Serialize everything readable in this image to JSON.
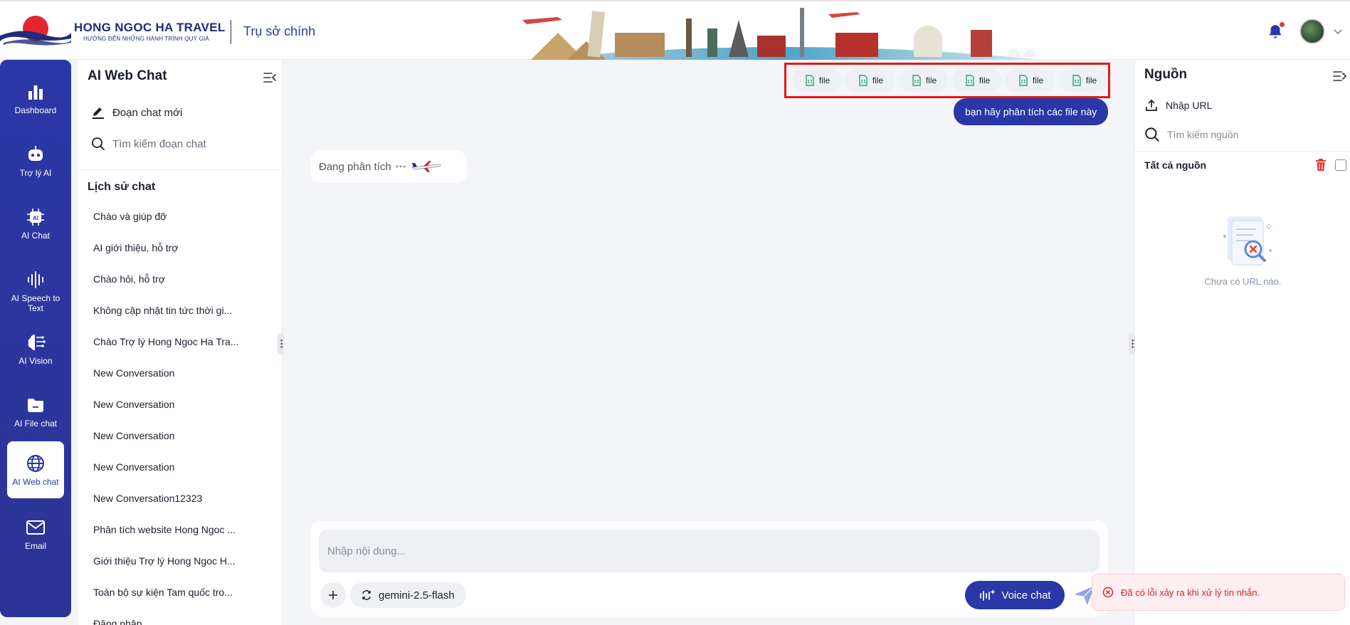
{
  "header": {
    "brand_name": "HONG NGOC HA TRAVEL",
    "brand_tagline": "HƯỚNG ĐẾN NHỮNG HÀNH TRÌNH QUÝ GIÁ",
    "office": "Trụ sở chính"
  },
  "nav": {
    "items": [
      {
        "label": "Dashboard",
        "icon": "bar-chart-icon"
      },
      {
        "label": "Trợ lý AI",
        "icon": "robot-icon"
      },
      {
        "label": "AI Chat",
        "icon": "ai-chip-icon"
      },
      {
        "label": "AI Speech to Text",
        "icon": "waveform-icon"
      },
      {
        "label": "AI Vision",
        "icon": "brain-icon"
      },
      {
        "label": "AI File chat",
        "icon": "folder-icon"
      },
      {
        "label": "AI Web chat",
        "icon": "globe-icon"
      },
      {
        "label": "Email",
        "icon": "mail-icon"
      }
    ],
    "active": "AI Web chat"
  },
  "chatlist": {
    "title": "AI Web Chat",
    "new_chat": "Đoạn chat mới",
    "search": "Tìm kiếm đoạn chat",
    "history_title": "Lịch sử chat",
    "items": [
      "Chào và giúp đỡ",
      "AI giới thiệu, hỗ trợ",
      "Chào hỏi, hỗ trợ",
      "Không cập nhật tin tức thời gi...",
      "Chào Trợ lý Hong Ngoc Ha Tra...",
      "New Conversation",
      "New Conversation",
      "New Conversation",
      "New Conversation",
      "New Conversation12323",
      "Phân tích website Hong Ngoc ...",
      "Giới thiệu Trợ lý Hong Ngoc H...",
      "Toàn bộ sự kiện Tam quốc tro...",
      "Đăng nhập"
    ]
  },
  "main": {
    "files": [
      "file",
      "file",
      "file",
      "file",
      "file",
      "file"
    ],
    "user_message": "bạn hãy phân tích các file này",
    "bot_status": "Đang phân tích",
    "input_placeholder": "Nhập nội dung...",
    "model": "gemini-2.5-flash",
    "voice_label": "Voice chat"
  },
  "sources": {
    "title": "Nguồn",
    "import_url": "Nhập URL",
    "search_placeholder": "Tìm kiếm nguồn",
    "all_sources": "Tất cả nguồn",
    "empty_text": "Chưa có URL nào."
  },
  "toast": {
    "message": "Đã có lỗi xảy ra khi xử lý tin nhắn."
  },
  "colors": {
    "primary": "#2a37a6",
    "file_icon": "#27a96b",
    "error": "#d12b2b",
    "highlight": "#e81717"
  }
}
